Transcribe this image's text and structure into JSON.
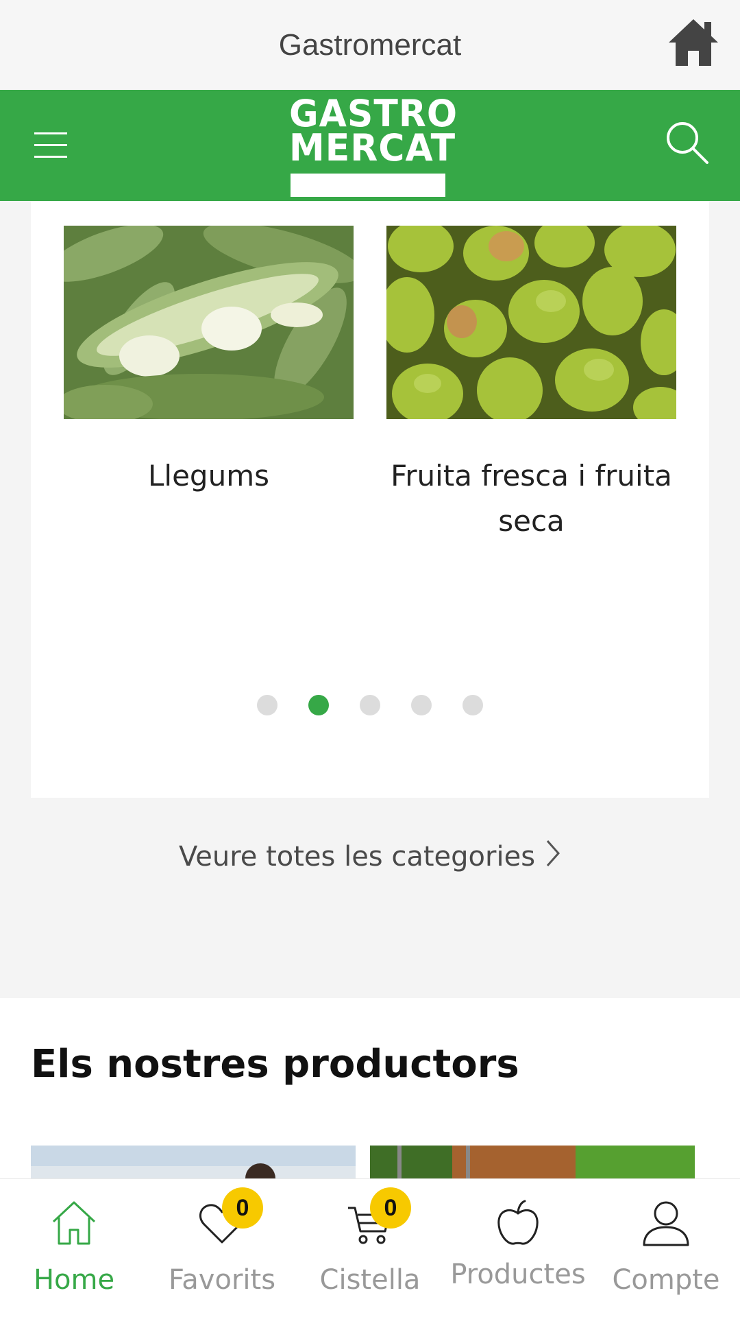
{
  "window": {
    "title": "Gastromercat"
  },
  "header": {
    "logo_line1": "GASTRO",
    "logo_line2": "MERCAT"
  },
  "categories": {
    "items": [
      {
        "label": "Llegums"
      },
      {
        "label": "Fruita fresca i fruita seca"
      }
    ],
    "carousel": {
      "count": 5,
      "active_index": 1
    },
    "see_all": "Veure totes les categories"
  },
  "producers": {
    "title": "Els nostres productors"
  },
  "tabbar": {
    "home": "Home",
    "favorites": "Favorits",
    "favorites_count": "0",
    "cart": "Cistella",
    "cart_count": "0",
    "products": "Productes",
    "account": "Compte"
  },
  "colors": {
    "brand_green": "#36a847",
    "badge_yellow": "#f7c900"
  }
}
